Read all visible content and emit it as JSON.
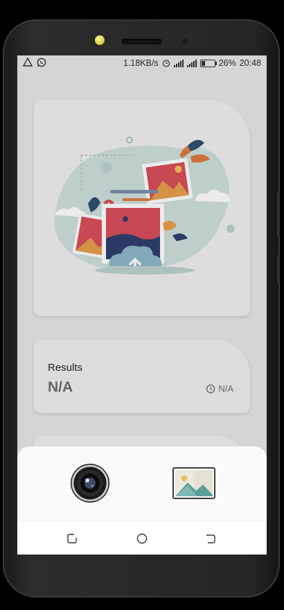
{
  "statusbar": {
    "left_icons": [
      "alert-triangle-icon",
      "whatsapp-icon"
    ],
    "net_speed": "1.18KB/s",
    "alarm_icon": "alarm-icon",
    "signal_icon": "signal-bars-icon",
    "battery_percent": "26%",
    "battery_level": 0.26,
    "time": "20:48"
  },
  "hero": {
    "illustration": "photo-upload-illustration-icon"
  },
  "results": {
    "title": "Results",
    "value": "N/A",
    "time_icon": "clock-icon",
    "time_value": "N/A"
  },
  "bottom_sheet": {
    "options": [
      {
        "icon": "camera-lens-icon"
      },
      {
        "icon": "gallery-image-icon"
      }
    ]
  },
  "navbar": {
    "buttons": [
      "recents-icon",
      "home-icon",
      "back-icon"
    ]
  },
  "colors": {
    "screen_background": "#e8e8e8",
    "card_background": "#f0f0f0",
    "sheet_background": "#fafafa",
    "accent_red": "#d94f5c",
    "accent_teal": "#7fb8b0"
  }
}
